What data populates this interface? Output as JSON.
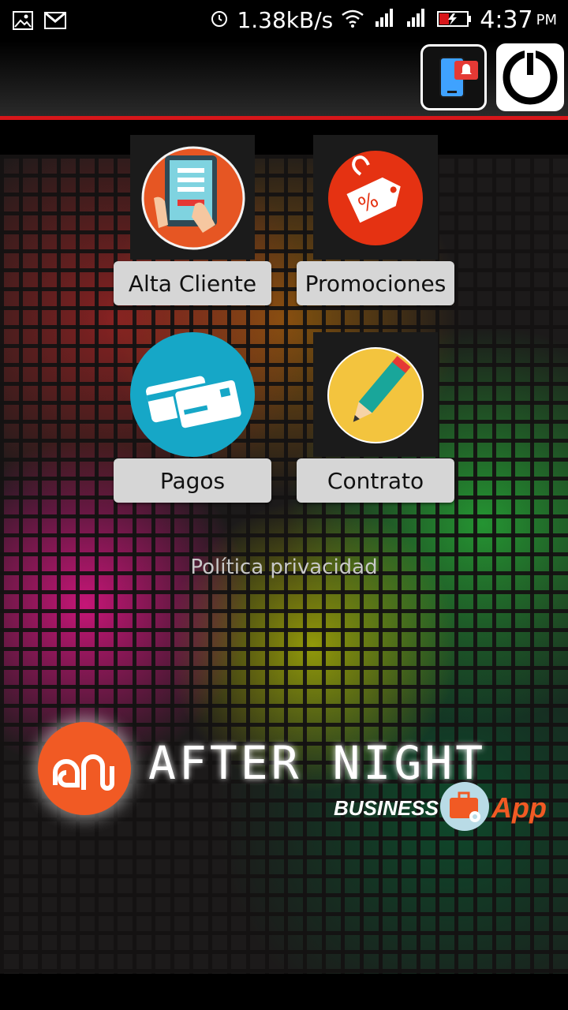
{
  "status_bar": {
    "speed": "1.38kB/s",
    "time": "4:37",
    "ampm": "PM",
    "icons": [
      "image-icon",
      "gmail-icon",
      "alarm-icon",
      "wifi-icon",
      "signal-h-icon",
      "signal-g-icon",
      "battery-charging-icon"
    ]
  },
  "app_bar": {
    "notify_icon": "phone-notification-icon",
    "power_icon": "power-icon",
    "accent_color": "#d7161a"
  },
  "menu": {
    "alta_cliente": "Alta Cliente",
    "promociones": "Promociones",
    "pagos": "Pagos",
    "contrato": "Contrato"
  },
  "policy_link": "Política privacidad",
  "logo": {
    "name": "AFTER NIGHT",
    "business": "BUSINESS",
    "app": "App",
    "brand_color": "#f15a24"
  }
}
